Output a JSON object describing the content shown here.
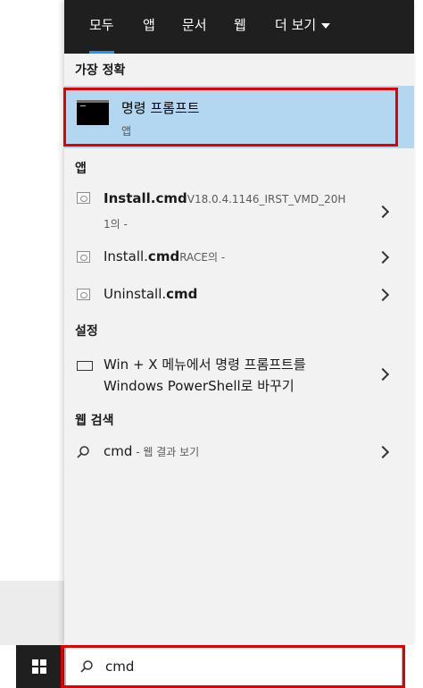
{
  "tabs": [
    {
      "label": "모두",
      "active": true
    },
    {
      "label": "앱"
    },
    {
      "label": "문서"
    },
    {
      "label": "웹"
    },
    {
      "label": "더 보기"
    }
  ],
  "best_match": {
    "header": "가장 정확",
    "title": "명령 프롬프트",
    "subtitle": "앱"
  },
  "apps": {
    "header": "앱",
    "items": [
      {
        "bold": "Install.cmd",
        "rest": "V18.0.4.1146_IRST_VMD_20H",
        "line2": "1의 -"
      },
      {
        "prefix": "Install.",
        "bold": "cmd",
        "rest": "RACE의 -"
      },
      {
        "prefix": "Uninstall.",
        "bold": "cmd"
      }
    ]
  },
  "settings": {
    "header": "설정",
    "item_line1": "Win + X 메뉴에서 명령 프롬프트를",
    "item_line2": "Windows PowerShell로 바꾸기"
  },
  "web": {
    "header": "웹 검색",
    "query": "cmd",
    "suffix": " - 웹 결과 보기"
  },
  "search": {
    "value": "cmd"
  },
  "colors": {
    "accent": "#1e90ff",
    "highlight_red": "#e00000",
    "selected_bg": "#b3d7f0",
    "tabbar_bg": "#1f1f1f"
  }
}
